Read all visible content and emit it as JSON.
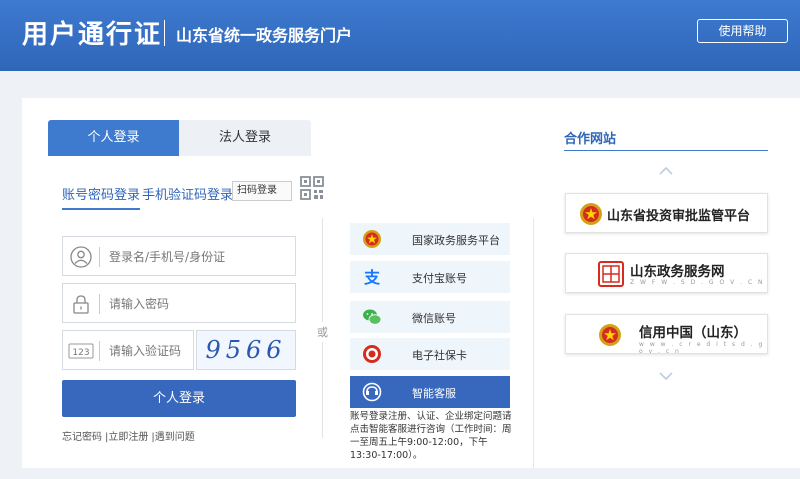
{
  "header": {
    "brand": "用户通行证",
    "subtitle": "山东省统一政务服务门户",
    "help_button": "使用帮助"
  },
  "tabs": {
    "personal": "个人登录",
    "legal": "法人登录"
  },
  "subtabs": {
    "password": "账号密码登录",
    "sms": "手机验证码登录",
    "scan": "扫码登录"
  },
  "form": {
    "username_placeholder": "登录名/手机号/身份证",
    "password_placeholder": "请输入密码",
    "captcha_placeholder": "请输入验证码",
    "captcha_icon_text": "123",
    "captcha_image_text": "9566",
    "login_button": "个人登录"
  },
  "links": {
    "forgot": "忘记密码",
    "register": "|立即注册",
    "problem": "|遇到问题"
  },
  "or_label": "或",
  "alt_login": [
    {
      "label": "国家政务服务平台",
      "icon": "national-emblem-icon"
    },
    {
      "label": "支付宝账号",
      "icon": "alipay-icon"
    },
    {
      "label": "微信账号",
      "icon": "wechat-icon"
    },
    {
      "label": "电子社保卡",
      "icon": "social-security-icon"
    },
    {
      "label": "智能客服",
      "icon": "customer-service-icon"
    }
  ],
  "alt_note": "账号登录注册、认证、企业绑定问题请点击智能客服进行咨询（工作时间：周一至周五上午9:00-12:00，下午13:30-17:00）。",
  "partners": {
    "title": "合作网站",
    "items": [
      {
        "label": "山东省投资审批监管平台"
      },
      {
        "label": "山东政务服务网",
        "url": "Z W F W . S D . G O V . C N"
      },
      {
        "label": "信用中国（山东）",
        "url": "w w w . c r e d i t s d . g o v . c n"
      }
    ]
  },
  "colors": {
    "primary": "#3768bd",
    "header": "#2f66b8",
    "tab_active": "#3e7ace",
    "alt_bg": "#eef5fb"
  }
}
